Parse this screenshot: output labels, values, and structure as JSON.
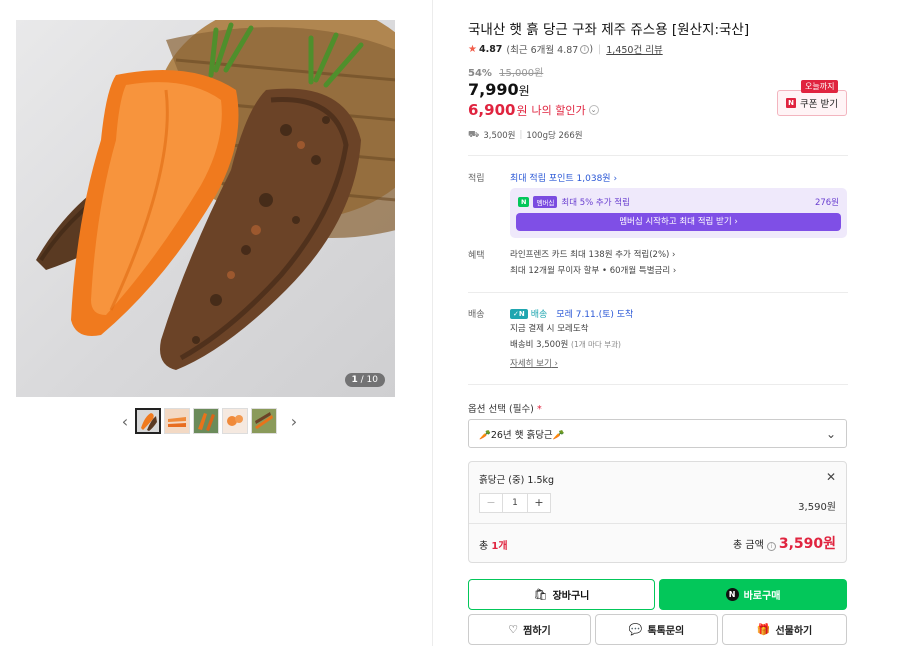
{
  "product": {
    "title": "국내산 햇 흙 당근 구좌 제주 쥬스용 [원산지:국산]",
    "rating": "4.87",
    "rating_recent": "(최근 6개월 4.87",
    "review_count": "1,450건 리뷰",
    "discount_pct": "54%",
    "original_price": "15,000원",
    "price": "7,990",
    "price_unit": "원",
    "my_price": "6,900",
    "my_price_unit": "원",
    "my_price_label": "나의 할인가",
    "shipping_fee": "3,500원",
    "unit_price": "100g당 266원",
    "image_counter_current": "1",
    "image_counter_total": "/ 10"
  },
  "coupon": {
    "tag": "오늘까지",
    "button_label": "쿠폰 받기"
  },
  "points": {
    "label": "적립",
    "max_points": "최대 적립 포인트 1,038원",
    "extra_label": "최대 5% 추가 적립",
    "npay_badge": "N",
    "membership_badge": "멤버십",
    "extra_amount": "276원",
    "cta": "멤버십 시작하고 최대 적립 받기"
  },
  "benefits": {
    "label": "혜택",
    "line1": "라인프렌즈 카드 최대 138원 추가 적립(2%)",
    "line2": "최대 12개월 무이자 할부 • 60개월 특별금리"
  },
  "delivery": {
    "label": "배송",
    "badge": "배송",
    "arrival": "모레 7.11.(토) 도착",
    "line1": "지금 결제 시 모레도착",
    "line2": "배송비 3,500원",
    "line2_sub": "(1개 마다 부과)",
    "detail_link": "자세히 보기"
  },
  "options": {
    "label": "옵션 선택 (필수)",
    "required_mark": "*",
    "selected": "26년 햇 흙당근",
    "selected_item": {
      "name": "흙당근 (중) 1.5kg",
      "quantity": "1",
      "price": "3,590원"
    },
    "total_count_prefix": "총",
    "total_count": "1개",
    "total_label": "총 금액",
    "total_amount": "3,590원"
  },
  "buttons": {
    "cart": "장바구니",
    "buy": "바로구매",
    "like": "찜하기",
    "talk": "톡톡문의",
    "gift": "선물하기"
  },
  "colors": {
    "accent_green": "#03c75a",
    "sale_red": "#e0243f",
    "membership_purple": "#7f4fe6"
  }
}
